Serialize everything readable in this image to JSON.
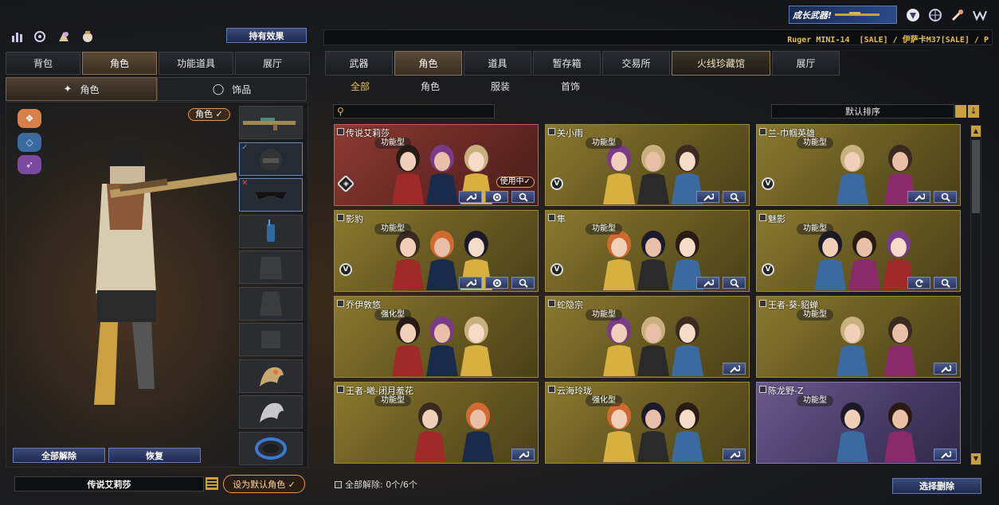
{
  "top_icons": [
    "stats-icon",
    "swap-icon",
    "craft-icon",
    "bag-icon"
  ],
  "effect_button": "持有效果",
  "left_tabs": [
    {
      "label": "背包",
      "active": false
    },
    {
      "label": "角色",
      "active": true
    },
    {
      "label": "功能道具",
      "active": false
    },
    {
      "label": "展厅",
      "active": false
    }
  ],
  "left_subtabs": [
    {
      "label": "角色",
      "active": true,
      "icon": "character-icon"
    },
    {
      "label": "饰品",
      "active": false,
      "icon": "ring-icon"
    }
  ],
  "role_badge": "角色 ✓",
  "unequip_all": "全部解除",
  "restore": "恢复",
  "current_role": "传说艾莉莎",
  "set_default": "设为默认角色 ✓",
  "banner": {
    "label": "成长武器!",
    "logos": [
      "shield-logo",
      "globe-logo",
      "crosshair-logo",
      "w-logo"
    ]
  },
  "ticker": "Ruger MINI-14  [SALE] / 伊萨卡M37[SALE] / P",
  "right_tabs": [
    {
      "label": "武器",
      "active": false
    },
    {
      "label": "角色",
      "active": true
    },
    {
      "label": "道具",
      "active": false
    },
    {
      "label": "暂存箱",
      "active": false
    },
    {
      "label": "交易所",
      "active": false
    },
    {
      "label": "火线珍藏馆",
      "active": false,
      "special": true
    },
    {
      "label": "展厅",
      "active": false
    }
  ],
  "filter_tabs": [
    {
      "label": "全部",
      "active": true
    },
    {
      "label": "角色",
      "active": false
    },
    {
      "label": "服装",
      "active": false
    },
    {
      "label": "首饰",
      "active": false
    }
  ],
  "sort_label": "默认排序",
  "cards": [
    {
      "name": "传说艾莉莎",
      "type": "功能型",
      "status": "使用中✓",
      "active": true,
      "buttons": [
        "settings-wrench",
        "settings-gear",
        "search"
      ],
      "figures": 3,
      "badge": "key"
    },
    {
      "name": "关小雨",
      "type": "功能型",
      "active": false,
      "buttons": [
        "settings-wrench",
        "search"
      ],
      "figures": 3,
      "badge": "V"
    },
    {
      "name": "兰-巾帼英雄",
      "type": "功能型",
      "active": false,
      "buttons": [
        "settings-wrench",
        "search"
      ],
      "figures": 2,
      "badge": "V"
    },
    {
      "name": "影豹",
      "type": "功能型",
      "active": false,
      "buttons": [
        "settings-wrench",
        "settings-gear",
        "search"
      ],
      "figures": 3,
      "badge": "V"
    },
    {
      "name": "隼",
      "type": "功能型",
      "active": false,
      "buttons": [
        "settings-wrench",
        "search"
      ],
      "figures": 3,
      "badge": "V"
    },
    {
      "name": "魅影",
      "type": "功能型",
      "active": false,
      "buttons": [
        "refresh",
        "search"
      ],
      "figures": 3,
      "badge": "V"
    },
    {
      "name": "乔伊敦悠",
      "type": "强化型",
      "active": false,
      "buttons": [],
      "figures": 3,
      "badge": ""
    },
    {
      "name": "蛇隐宗",
      "type": "功能型",
      "active": false,
      "buttons": [
        "settings-wrench"
      ],
      "figures": 3,
      "badge": ""
    },
    {
      "name": "王者-葵-貂蝉",
      "type": "功能型",
      "active": false,
      "buttons": [
        "settings-wrench"
      ],
      "figures": 2,
      "badge": ""
    },
    {
      "name": "王者-曦-闭月羞花",
      "type": "功能型",
      "active": false,
      "buttons": [
        "settings-wrench"
      ],
      "figures": 2,
      "badge": ""
    },
    {
      "name": "云海玲珑",
      "type": "强化型",
      "active": false,
      "buttons": [
        "settings-wrench"
      ],
      "figures": 3,
      "badge": ""
    },
    {
      "name": "陈龙野-Z",
      "type": "功能型",
      "active": false,
      "purple": true,
      "buttons": [
        "settings-wrench"
      ],
      "figures": 2,
      "badge": ""
    }
  ],
  "footer_label": "全部解除: 0个/6个",
  "delete_button": "选择删除"
}
